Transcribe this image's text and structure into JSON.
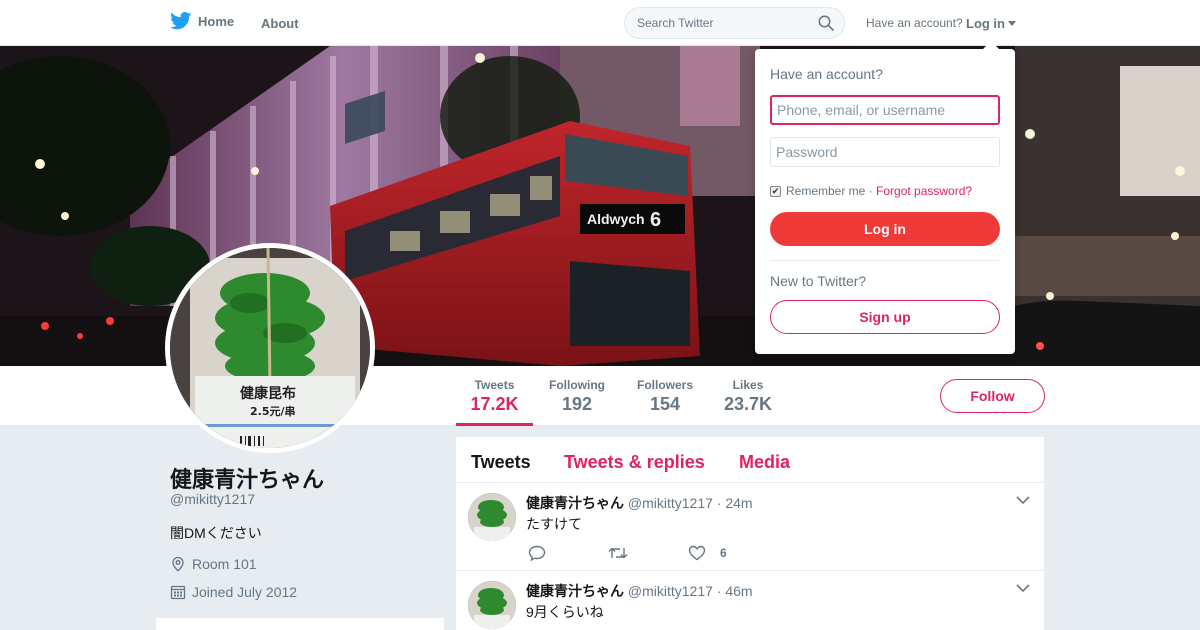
{
  "nav": {
    "home_label": "Home",
    "about_label": "About"
  },
  "search": {
    "placeholder": "Search Twitter"
  },
  "account": {
    "prompt": "Have an account?",
    "login_label": "Log in"
  },
  "stats": [
    {
      "label": "Tweets",
      "value": "17.2K"
    },
    {
      "label": "Following",
      "value": "192"
    },
    {
      "label": "Followers",
      "value": "154"
    },
    {
      "label": "Likes",
      "value": "23.7K"
    }
  ],
  "follow_label": "Follow",
  "profile": {
    "name": "健康青汁ちゃん",
    "handle": "@mikitty1217",
    "bio": "闇DMください",
    "location": "Room 101",
    "joined": "Joined July 2012"
  },
  "timeline": {
    "tabs": [
      "Tweets",
      "Tweets & replies",
      "Media"
    ],
    "tweets": [
      {
        "name": "健康青汁ちゃん",
        "handle": "@mikitty1217",
        "time": "· 24m",
        "text": "たすけて",
        "likes": "6"
      },
      {
        "name": "健康青汁ちゃん",
        "handle": "@mikitty1217",
        "time": "· 46m",
        "text": "9月くらいね",
        "likes": ""
      }
    ]
  },
  "login_dropdown": {
    "title": "Have an account?",
    "user_placeholder": "Phone, email, or username",
    "password_placeholder": "Password",
    "remember_label": "Remember me",
    "forgot_label": "Forgot password?",
    "login_button": "Log in",
    "new_prompt": "New to Twitter?",
    "signup_button": "Sign up"
  },
  "banner_text": {
    "bus_sign": "Aldwych",
    "bus_route": "6"
  },
  "avatar_text": {
    "product": "健康昆布",
    "price": "2.5元/串"
  },
  "colors": {
    "accent": "#e0245e",
    "login_button": "#f03a3a",
    "twitter_blue": "#1da1f2"
  }
}
